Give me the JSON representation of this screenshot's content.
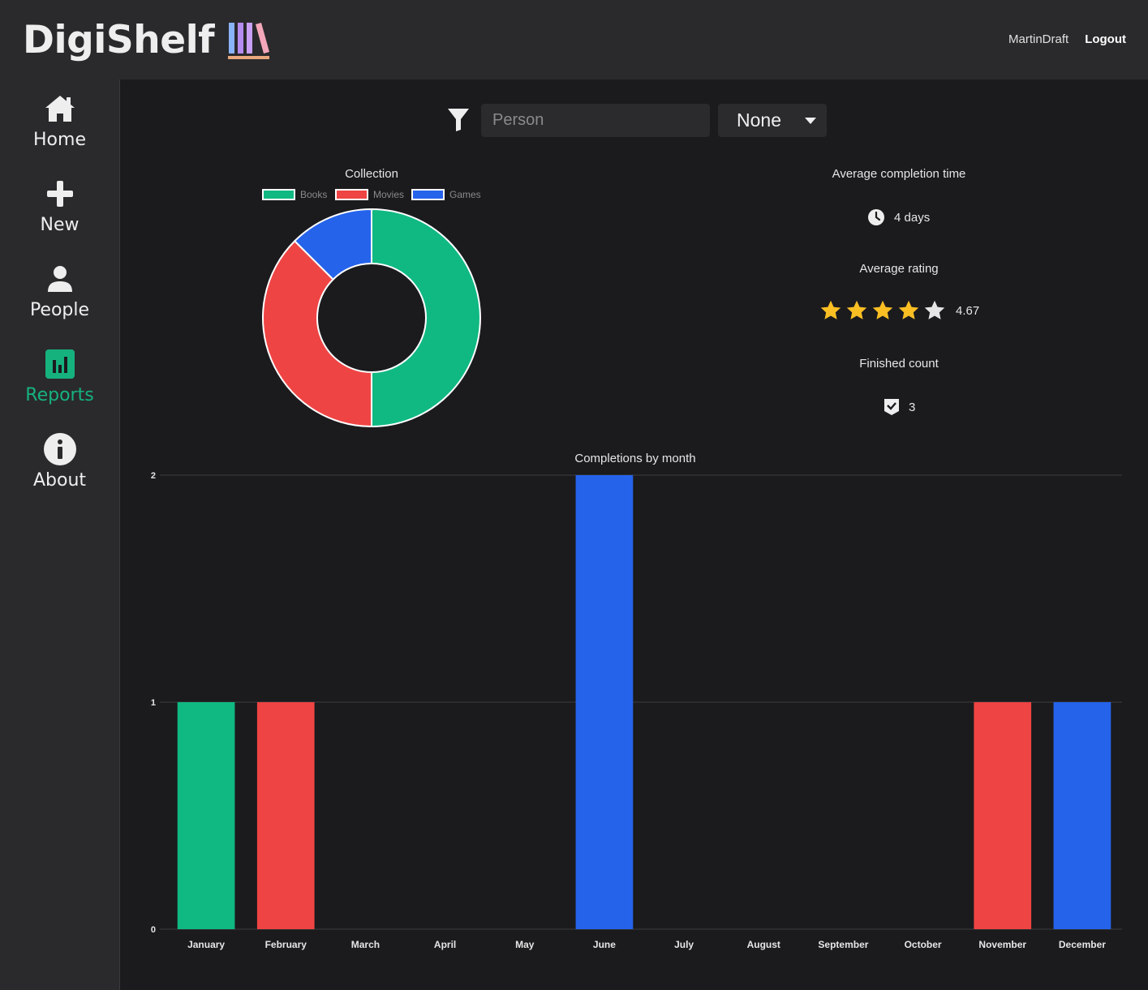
{
  "header": {
    "logo_text": "DigiShelf",
    "username": "MartinDraft",
    "logout_label": "Logout"
  },
  "sidebar": {
    "items": [
      {
        "label": "Home",
        "icon": "home-icon",
        "active": false
      },
      {
        "label": "New",
        "icon": "plus-icon",
        "active": false
      },
      {
        "label": "People",
        "icon": "person-icon",
        "active": false
      },
      {
        "label": "Reports",
        "icon": "bar-chart-icon",
        "active": true
      },
      {
        "label": "About",
        "icon": "info-icon",
        "active": false
      }
    ],
    "active_color": "#16b27e"
  },
  "filter": {
    "person_placeholder": "Person",
    "person_value": "",
    "select_value": "None"
  },
  "stats": {
    "avg_completion_title": "Average completion time",
    "avg_completion_value": "4 days",
    "avg_rating_title": "Average rating",
    "avg_rating_value": "4.67",
    "rating_stars": 4.67,
    "finished_title": "Finished count",
    "finished_value": "3"
  },
  "colors": {
    "books": "#10b981",
    "movies": "#ef4444",
    "games": "#2563eb",
    "star": "#fbbf24",
    "star_empty": "#e5e5e5"
  },
  "chart_data": [
    {
      "type": "pie",
      "title": "Collection",
      "categories": [
        "Books",
        "Movies",
        "Games"
      ],
      "values": [
        4,
        3,
        1
      ],
      "colors": [
        "#10b981",
        "#ef4444",
        "#2563eb"
      ],
      "legend": "top"
    },
    {
      "type": "bar",
      "title": "Completions by month",
      "categories": [
        "January",
        "February",
        "March",
        "April",
        "May",
        "June",
        "July",
        "August",
        "September",
        "October",
        "November",
        "December"
      ],
      "values": [
        1,
        1,
        0,
        0,
        0,
        2,
        0,
        0,
        0,
        0,
        1,
        1
      ],
      "bar_colors": [
        "#10b981",
        "#ef4444",
        "#10b981",
        "#10b981",
        "#10b981",
        "#2563eb",
        "#10b981",
        "#10b981",
        "#10b981",
        "#10b981",
        "#ef4444",
        "#2563eb"
      ],
      "ylim": [
        0,
        2
      ],
      "yticks": [
        0,
        1,
        2
      ],
      "grid": true
    }
  ]
}
